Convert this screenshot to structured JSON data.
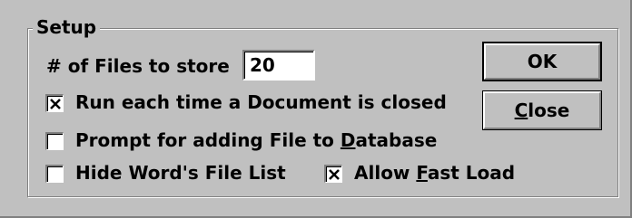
{
  "group": {
    "title": "Setup"
  },
  "files_to_store": {
    "label": "# of Files to store",
    "value": "20"
  },
  "options": {
    "run_each_time": {
      "label": "Run each time a Document is closed",
      "checked": true
    },
    "prompt_adding": {
      "label_pre": "Prompt for adding File to ",
      "label_u": "D",
      "label_post": "atabase",
      "checked": false
    },
    "hide_file_list": {
      "label": "Hide Word's File List",
      "checked": false
    },
    "allow_fast_load": {
      "label_pre": "Allow ",
      "label_u": "F",
      "label_post": "ast Load",
      "checked": true
    }
  },
  "buttons": {
    "ok": {
      "label": "OK"
    },
    "close": {
      "label_u": "C",
      "label_post": "lose"
    }
  }
}
